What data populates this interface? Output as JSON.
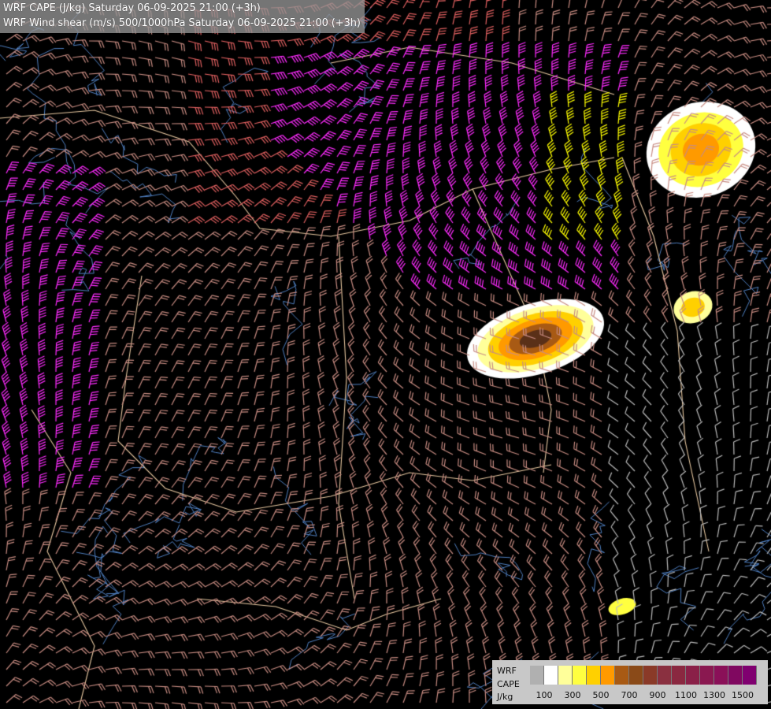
{
  "titles": {
    "line1": "WRF CAPE (J/kg) Saturday 06-09-2025 21:00 (+3h)",
    "line2": "WRF Wind shear (m/s) 500/1000hPa Saturday 06-09-2025 21:00 (+3h)"
  },
  "legend": {
    "model": "WRF",
    "field": "CAPE",
    "unit": "J/kg",
    "ticks": [
      "100",
      "300",
      "500",
      "700",
      "900",
      "1100",
      "1300",
      "1500"
    ],
    "colors": [
      "#b0b0b0",
      "#ffffff",
      "#ffff9a",
      "#ffff40",
      "#ffd000",
      "#ff9a00",
      "#a85a14",
      "#8a4a18",
      "#8a3a28",
      "#8a3040",
      "#8a2840",
      "#8a2048",
      "#8a1850",
      "#8a1058",
      "#800860",
      "#800070"
    ]
  },
  "colors": {
    "background": "#000000",
    "barb_weak": "#bbbbbb",
    "barb_mid": "#c88c82",
    "barb_strong": "#e06060",
    "barb_very_strong": "#ff2cff",
    "barb_max": "#ffff00",
    "borders": "#e8c8a0",
    "rivers": "#4f7fc0"
  }
}
